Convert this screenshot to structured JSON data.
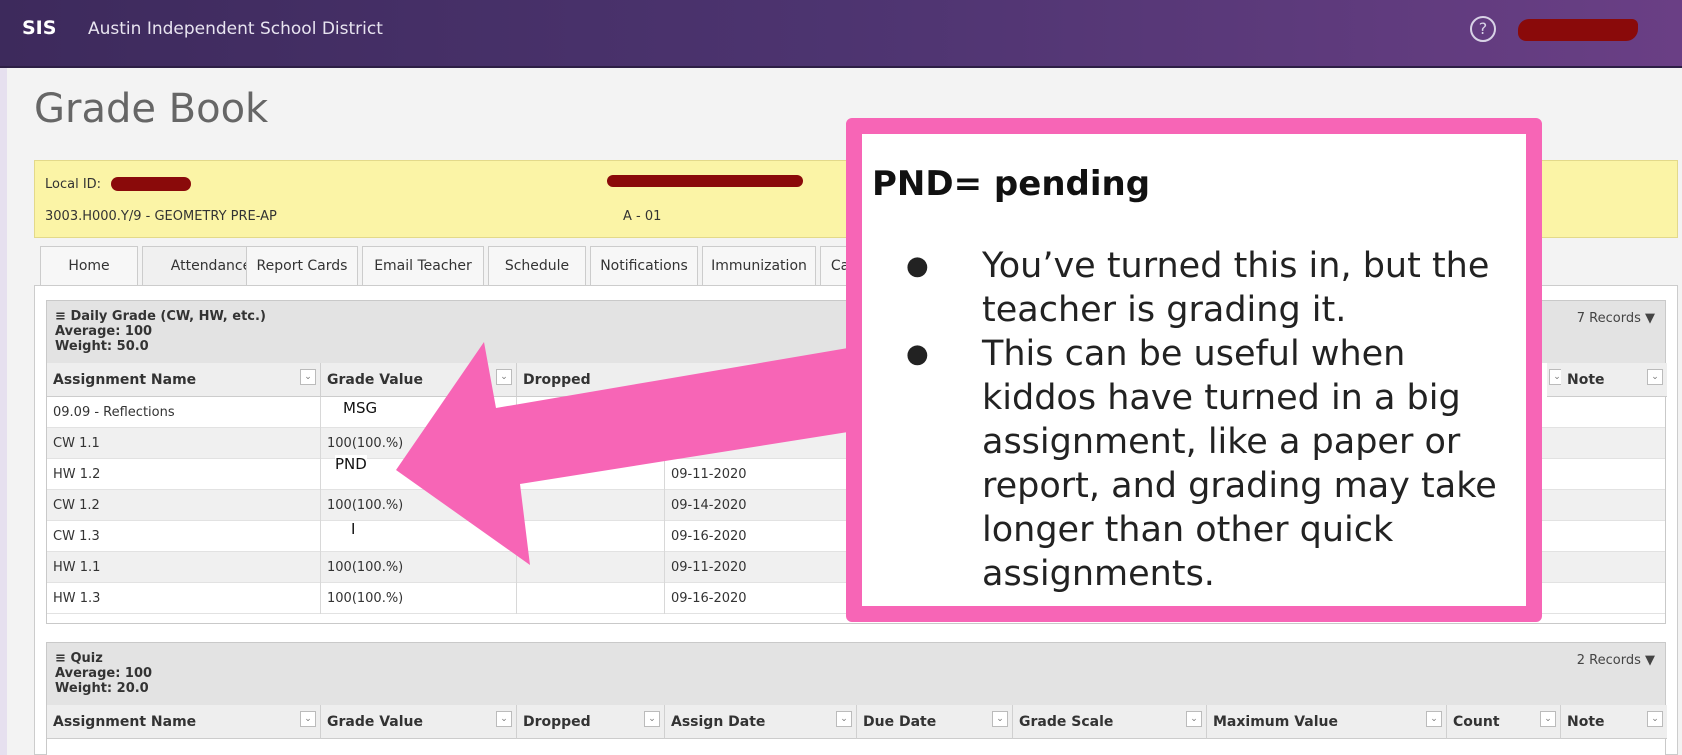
{
  "topbar": {
    "app": "SIS",
    "district": "Austin Independent School District",
    "help_glyph": "?"
  },
  "page_title": "Grade Book",
  "student": {
    "local_id_label": "Local ID:",
    "course": "3003.H000.Y/9 - GEOMETRY PRE-AP",
    "section": "A - 01"
  },
  "tabs": [
    "Home",
    "Attendance",
    "Report Cards",
    "Email Teacher",
    "Schedule",
    "Notifications",
    "Immunization",
    "Ca"
  ],
  "daily": {
    "title": "Daily Grade (CW, HW, etc.)",
    "average": "Average: 100",
    "weight": "Weight: 50.0",
    "records": "7 Records",
    "columns": [
      "Assignment Name",
      "Grade Value",
      "Dropped"
    ],
    "last_columns": [
      "Note"
    ],
    "rows": [
      {
        "name": "09.09 - Reflections",
        "grade": "",
        "date": ""
      },
      {
        "name": "CW 1.1",
        "grade": "100(100.%)",
        "date": ""
      },
      {
        "name": "HW 1.2",
        "grade": "",
        "date": "09-11-2020"
      },
      {
        "name": "CW 1.2",
        "grade": "100(100.%)",
        "date": "09-14-2020"
      },
      {
        "name": "CW 1.3",
        "grade": "",
        "date": "09-16-2020"
      },
      {
        "name": "HW 1.1",
        "grade": "100(100.%)",
        "date": "09-11-2020"
      },
      {
        "name": "HW 1.3",
        "grade": "100(100.%)",
        "date": "09-16-2020"
      }
    ],
    "overlays": {
      "msg": "MSG",
      "pnd": "PND",
      "i": "I"
    }
  },
  "quiz": {
    "title": "Quiz",
    "average": "Average: 100",
    "weight": "Weight: 20.0",
    "records": "2 Records",
    "columns": [
      "Assignment Name",
      "Grade Value",
      "Dropped",
      "Assign Date",
      "Due Date",
      "Grade Scale",
      "Maximum Value",
      "Count",
      "Note"
    ]
  },
  "callout": {
    "heading": "PND= pending",
    "bullets": [
      "You’ve turned this in, but the teacher is grading it.",
      "This can be useful when kiddos have turned in a big assignment, like a paper or report, and grading may take longer than other quick assignments."
    ],
    "accent": "#f765b6"
  },
  "icons": {
    "menu": "hamburger-icon",
    "dropdown": "caret-down-icon",
    "help": "help-circle-icon"
  }
}
